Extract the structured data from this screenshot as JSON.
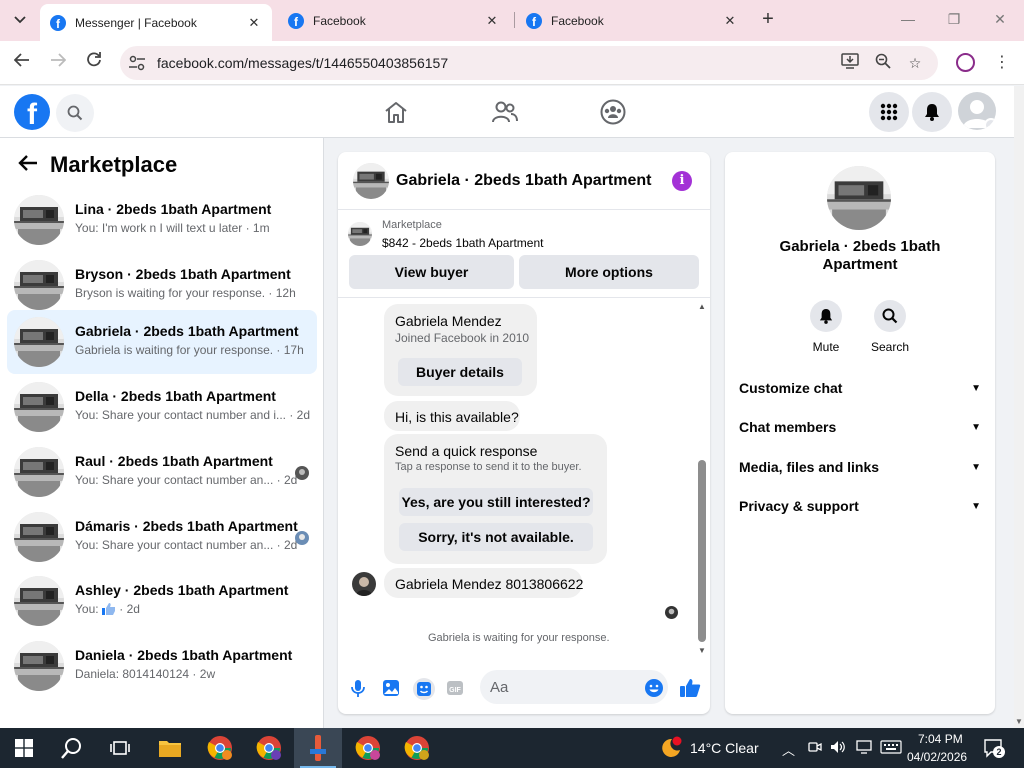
{
  "browser": {
    "tabs": [
      {
        "title": "Messenger | Facebook",
        "active": true
      },
      {
        "title": "Facebook",
        "active": false
      },
      {
        "title": "Facebook",
        "active": false
      }
    ],
    "url": "facebook.com/messages/t/1446550403856157"
  },
  "sidebar": {
    "title": "Marketplace",
    "conversations": [
      {
        "name": "Lina · 2beds 1bath Apartment",
        "snippet": "You: I'm work n I will text u later · 1m",
        "selected": false
      },
      {
        "name": "Bryson · 2beds 1bath Apartment",
        "snippet": "Bryson is waiting for your response. · 12h",
        "selected": false
      },
      {
        "name": "Gabriela · 2beds 1bath Apartment",
        "snippet": "Gabriela is waiting for your response. · 17h",
        "selected": true
      },
      {
        "name": "Della · 2beds 1bath Apartment",
        "snippet": "You: Share your contact number and i... · 2d",
        "selected": false
      },
      {
        "name": "Raul · 2beds 1bath Apartment",
        "snippet": "You: Share your contact number an... · 2d",
        "selected": false
      },
      {
        "name": "Dámaris · 2beds 1bath Apartment",
        "snippet": "You: Share your contact number an... · 2d",
        "selected": false
      },
      {
        "name": "Ashley · 2beds 1bath Apartment",
        "snippet_prefix": "You: ",
        "snippet_suffix": " · 2d",
        "selected": false
      },
      {
        "name": "Daniela · 2beds 1bath Apartment",
        "snippet": "Daniela: 8014140124 · 2w",
        "selected": false
      }
    ]
  },
  "chat": {
    "title": "Gabriela · 2beds 1bath Apartment",
    "listing_source": "Marketplace",
    "listing_item": "$842 - 2beds 1bath Apartment",
    "view_buyer": "View buyer",
    "more_options": "More options",
    "buyer_card": {
      "name": "Gabriela Mendez",
      "joined": "Joined Facebook in 2010",
      "button": "Buyer details"
    },
    "msg_available": "Hi, is this available?",
    "quick": {
      "title": "Send a quick response",
      "subtitle": "Tap a response to send it to the buyer.",
      "option1": "Yes, are you still interested?",
      "option2": "Sorry, it's not available."
    },
    "msg_number": "Gabriela Mendez 8013806622",
    "waiting": "Gabriela is waiting for your response.",
    "composer_placeholder": "Aa"
  },
  "info_panel": {
    "name": "Gabriela · 2beds 1bath Apartment",
    "mute": "Mute",
    "search": "Search",
    "sections": [
      "Customize chat",
      "Chat members",
      "Media, files and links",
      "Privacy & support"
    ]
  },
  "taskbar": {
    "weather": "14°C  Clear",
    "time": "7:04 PM",
    "date": "04/02/2026",
    "notifications": "2"
  },
  "colors": {
    "fb_blue": "#1877f2",
    "selected_row": "#e7f3ff",
    "info_purple": "#a332d6",
    "tabbar": "#f6dfe6"
  }
}
